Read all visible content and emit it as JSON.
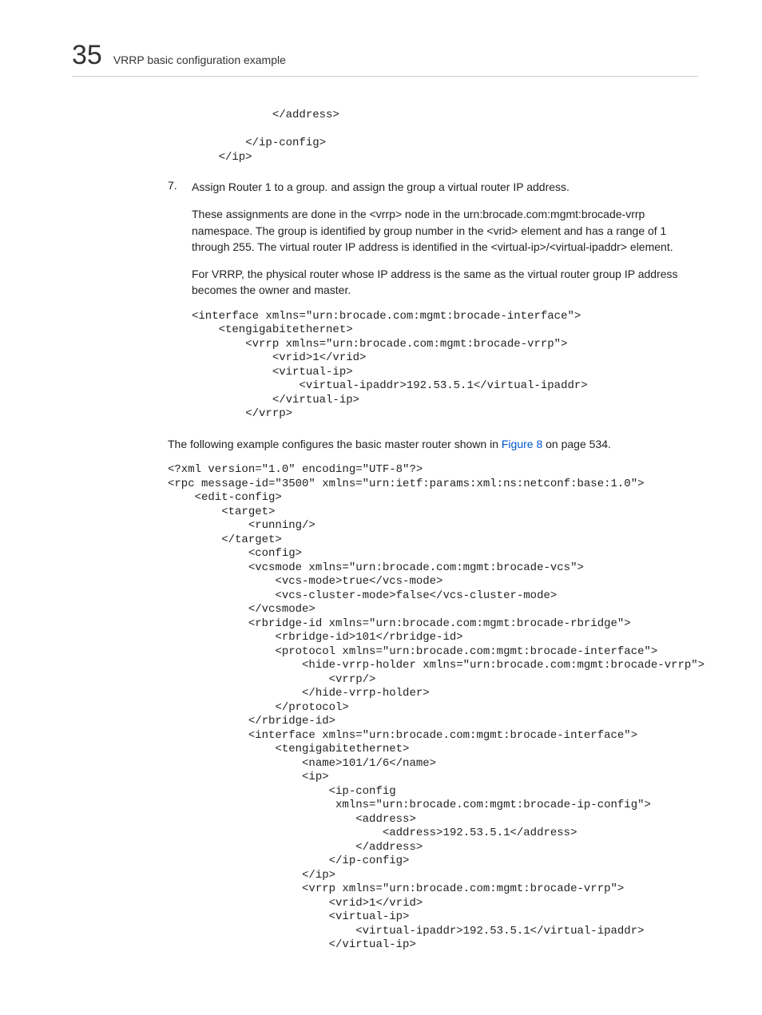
{
  "header": {
    "chapter_num": "35",
    "section_title": "VRRP basic configuration example"
  },
  "code_top": "            </address>\n\n        </ip-config>\n    </ip>",
  "step7": {
    "num": "7.",
    "text": "Assign Router 1 to a group. and assign the group a virtual router IP address."
  },
  "para1": "These assignments are done in the <vrrp> node in the urn:brocade.com:mgmt:brocade-vrrp namespace. The group is identified by group number in the <vrid> element and has a range of 1 through 255. The virtual router IP address is identified in the <virtual-ip>/<virtual-ipaddr> element.",
  "para2": "For VRRP, the physical router whose IP address is the same as the virtual router group IP address becomes the owner and master.",
  "code_mid": "<interface xmlns=\"urn:brocade.com:mgmt:brocade-interface\">\n    <tengigabitethernet>\n        <vrrp xmlns=\"urn:brocade.com:mgmt:brocade-vrrp\">\n            <vrid>1</vrid>\n            <virtual-ip>\n                <virtual-ipaddr>192.53.5.1</virtual-ipaddr>\n            </virtual-ip>\n        </vrrp>",
  "para3": {
    "pre": "The following example configures the basic master router shown in ",
    "link": "Figure 8",
    "post": " on page 534."
  },
  "code_bottom": "<?xml version=\"1.0\" encoding=\"UTF-8\"?>\n<rpc message-id=\"3500\" xmlns=\"urn:ietf:params:xml:ns:netconf:base:1.0\">\n    <edit-config>\n        <target>\n            <running/>\n        </target>\n            <config>\n            <vcsmode xmlns=\"urn:brocade.com:mgmt:brocade-vcs\">\n                <vcs-mode>true</vcs-mode>\n                <vcs-cluster-mode>false</vcs-cluster-mode>\n            </vcsmode>\n            <rbridge-id xmlns=\"urn:brocade.com:mgmt:brocade-rbridge\">\n                <rbridge-id>101</rbridge-id>\n                <protocol xmlns=\"urn:brocade.com:mgmt:brocade-interface\">\n                    <hide-vrrp-holder xmlns=\"urn:brocade.com:mgmt:brocade-vrrp\">\n                        <vrrp/>\n                    </hide-vrrp-holder>\n                </protocol>\n            </rbridge-id>\n            <interface xmlns=\"urn:brocade.com:mgmt:brocade-interface\">\n                <tengigabitethernet>\n                    <name>101/1/6</name>\n                    <ip>\n                        <ip-config\n                         xmlns=\"urn:brocade.com:mgmt:brocade-ip-config\">\n                            <address>\n                                <address>192.53.5.1</address>\n                            </address>\n                        </ip-config>\n                    </ip>\n                    <vrrp xmlns=\"urn:brocade.com:mgmt:brocade-vrrp\">\n                        <vrid>1</vrid>\n                        <virtual-ip>\n                            <virtual-ipaddr>192.53.5.1</virtual-ipaddr>\n                        </virtual-ip>"
}
